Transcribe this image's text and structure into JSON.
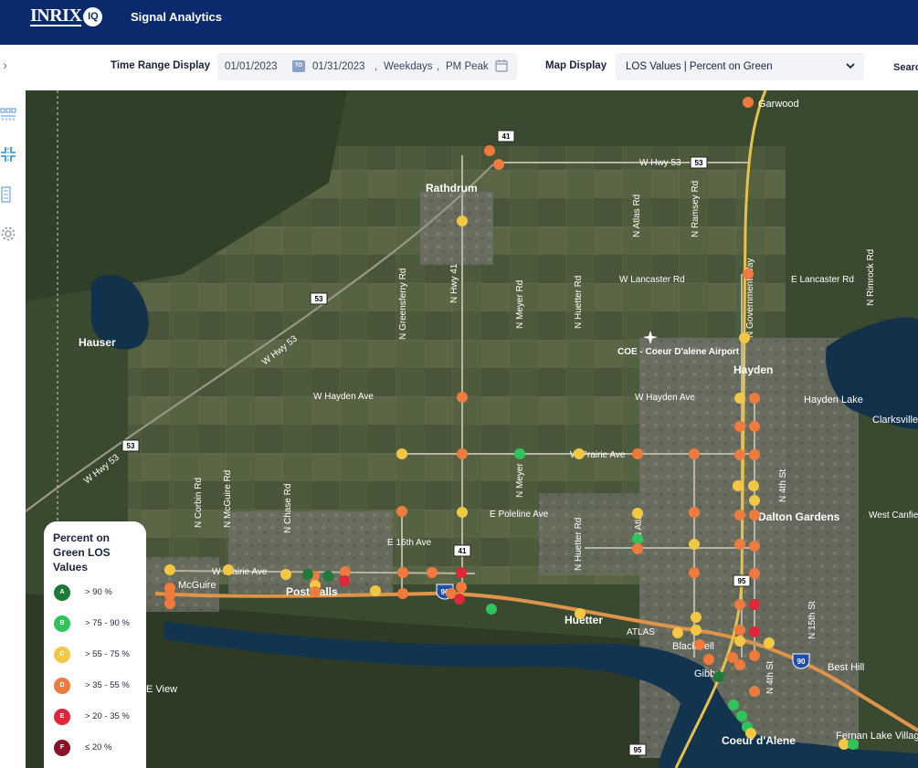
{
  "app": {
    "logo_text": "INRIX",
    "logo_badge": "IQ",
    "title": "Signal Analytics"
  },
  "toolbar": {
    "time_range_label": "Time Range Display",
    "start_date": "01/01/2023",
    "to_badge": "TO",
    "end_date": "01/31/2023",
    "days": "Weekdays",
    "period": "PM Peak",
    "map_display_label": "Map Display",
    "map_display_value": "LOS Values | Percent on Green",
    "search_label": "Search"
  },
  "sidebar": {
    "expand_icon": "chevron-right-icon",
    "items": [
      {
        "name": "corridor-icon"
      },
      {
        "name": "intersection-icon"
      },
      {
        "name": "report-icon"
      },
      {
        "name": "gear-icon"
      }
    ]
  },
  "map": {
    "place_labels": [
      "Rathdrum",
      "Garwood",
      "Hauser",
      "COE - Coeur D'alene Airport",
      "Hayden",
      "Hayden Lake",
      "Clarksville",
      "Dalton Gardens",
      "West Canfield",
      "Post Falls",
      "McGuire",
      "Huetter",
      "ATLAS",
      "Blackwell",
      "Gibbs",
      "Coeur d'Alene",
      "Best Hill",
      "Fernan Lake Village",
      "E View"
    ],
    "road_labels": [
      "W Hwy 53",
      "W Lancaster Rd",
      "E Lancaster Rd",
      "W Hayden Ave",
      "W Prairie Ave",
      "E Poleline Ave",
      "E 16th Ave",
      "W Prairie Ave",
      "N Hwy 41",
      "N Greensferry Rd",
      "N Meyer Rd",
      "N Huetter Rd",
      "N Atlas Rd",
      "N Ramsey Rd",
      "N Government Way",
      "N Rimrock Rd",
      "N 4th St",
      "N 15th St",
      "N Corbin Rd",
      "N McGuire Rd",
      "N Chase Rd",
      "N Meyer",
      "N Huetter Rd",
      "N Atlas",
      "N 4th St",
      "W Hwy 53"
    ],
    "shields": [
      "41",
      "53",
      "53",
      "53",
      "41",
      "95",
      "90",
      "90",
      "95"
    ]
  },
  "legend": {
    "title": "Percent on Green LOS Values",
    "items": [
      {
        "grade": "A",
        "range": "> 90 %",
        "color": "#1f7a3a"
      },
      {
        "grade": "B",
        "range": "> 75 - 90 %",
        "color": "#2ec45a"
      },
      {
        "grade": "C",
        "range": "> 55 - 75 %",
        "color": "#f2c744"
      },
      {
        "grade": "D",
        "range": "> 35 - 55 %",
        "color": "#ef7a3d"
      },
      {
        "grade": "E",
        "range": "> 20 - 35 %",
        "color": "#e0263a"
      },
      {
        "grade": "F",
        "range": "≤ 20 %",
        "color": "#8c1228"
      }
    ]
  }
}
